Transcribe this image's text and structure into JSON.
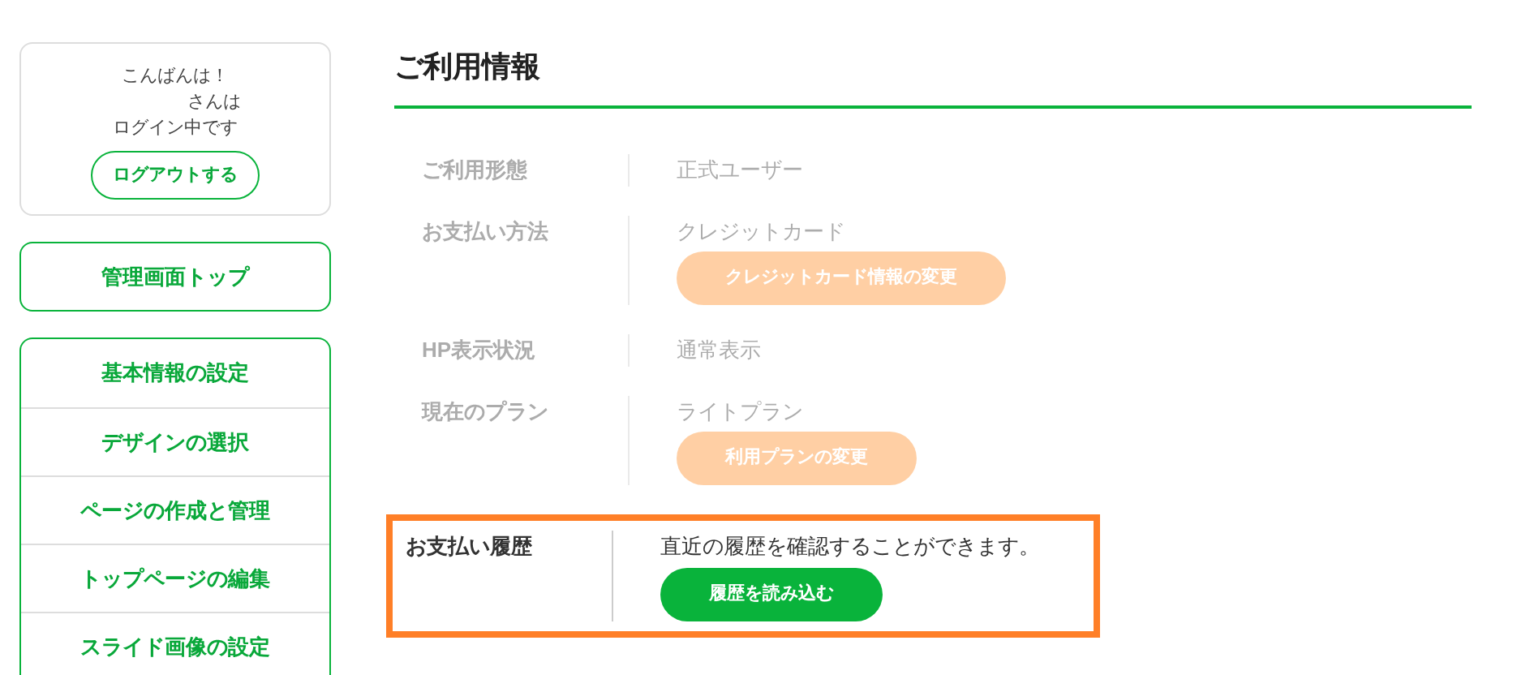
{
  "user_card": {
    "greeting": "こんばんは！",
    "name_suffix": "さんは",
    "status": "ログイン中です",
    "logout_button": "ログアウトする"
  },
  "top_button": "管理画面トップ",
  "menu": [
    {
      "label": "基本情報の設定"
    },
    {
      "label": "デザインの選択"
    },
    {
      "label": "ページの作成と管理"
    },
    {
      "label": "トップページの編集"
    },
    {
      "label": "スライド画像の設定"
    }
  ],
  "main": {
    "title": "ご利用情報",
    "rows": [
      {
        "label": "ご利用形態",
        "value": "正式ユーザー",
        "highlighted": false
      },
      {
        "label": "お支払い方法",
        "value": "クレジットカード",
        "highlighted": false,
        "button": {
          "label": "クレジットカード情報の変更",
          "kind": "change"
        }
      },
      {
        "label": "HP表示状況",
        "value": "通常表示",
        "highlighted": false
      },
      {
        "label": "現在のプラン",
        "value": "ライトプラン",
        "highlighted": false,
        "button": {
          "label": "利用プランの変更",
          "kind": "change"
        }
      },
      {
        "label": "お支払い履歴",
        "value": "直近の履歴を確認することができます。",
        "highlighted": true,
        "button": {
          "label": "履歴を読み込む",
          "kind": "load"
        }
      }
    ]
  }
}
